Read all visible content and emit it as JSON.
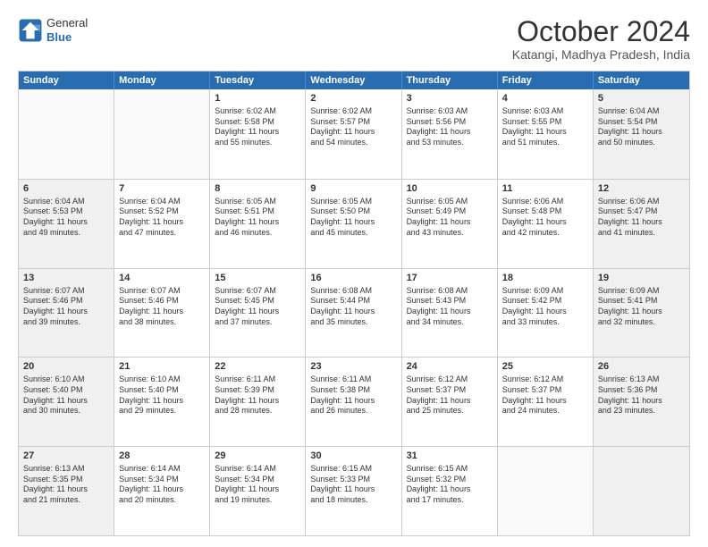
{
  "header": {
    "logo": {
      "general": "General",
      "blue": "Blue"
    },
    "title": "October 2024",
    "subtitle": "Katangi, Madhya Pradesh, India"
  },
  "days_of_week": [
    "Sunday",
    "Monday",
    "Tuesday",
    "Wednesday",
    "Thursday",
    "Friday",
    "Saturday"
  ],
  "weeks": [
    [
      {
        "day": "",
        "empty": true,
        "shaded": false,
        "lines": []
      },
      {
        "day": "",
        "empty": true,
        "shaded": false,
        "lines": []
      },
      {
        "day": "1",
        "empty": false,
        "shaded": false,
        "lines": [
          "Sunrise: 6:02 AM",
          "Sunset: 5:58 PM",
          "Daylight: 11 hours",
          "and 55 minutes."
        ]
      },
      {
        "day": "2",
        "empty": false,
        "shaded": false,
        "lines": [
          "Sunrise: 6:02 AM",
          "Sunset: 5:57 PM",
          "Daylight: 11 hours",
          "and 54 minutes."
        ]
      },
      {
        "day": "3",
        "empty": false,
        "shaded": false,
        "lines": [
          "Sunrise: 6:03 AM",
          "Sunset: 5:56 PM",
          "Daylight: 11 hours",
          "and 53 minutes."
        ]
      },
      {
        "day": "4",
        "empty": false,
        "shaded": false,
        "lines": [
          "Sunrise: 6:03 AM",
          "Sunset: 5:55 PM",
          "Daylight: 11 hours",
          "and 51 minutes."
        ]
      },
      {
        "day": "5",
        "empty": false,
        "shaded": true,
        "lines": [
          "Sunrise: 6:04 AM",
          "Sunset: 5:54 PM",
          "Daylight: 11 hours",
          "and 50 minutes."
        ]
      }
    ],
    [
      {
        "day": "6",
        "empty": false,
        "shaded": true,
        "lines": [
          "Sunrise: 6:04 AM",
          "Sunset: 5:53 PM",
          "Daylight: 11 hours",
          "and 49 minutes."
        ]
      },
      {
        "day": "7",
        "empty": false,
        "shaded": false,
        "lines": [
          "Sunrise: 6:04 AM",
          "Sunset: 5:52 PM",
          "Daylight: 11 hours",
          "and 47 minutes."
        ]
      },
      {
        "day": "8",
        "empty": false,
        "shaded": false,
        "lines": [
          "Sunrise: 6:05 AM",
          "Sunset: 5:51 PM",
          "Daylight: 11 hours",
          "and 46 minutes."
        ]
      },
      {
        "day": "9",
        "empty": false,
        "shaded": false,
        "lines": [
          "Sunrise: 6:05 AM",
          "Sunset: 5:50 PM",
          "Daylight: 11 hours",
          "and 45 minutes."
        ]
      },
      {
        "day": "10",
        "empty": false,
        "shaded": false,
        "lines": [
          "Sunrise: 6:05 AM",
          "Sunset: 5:49 PM",
          "Daylight: 11 hours",
          "and 43 minutes."
        ]
      },
      {
        "day": "11",
        "empty": false,
        "shaded": false,
        "lines": [
          "Sunrise: 6:06 AM",
          "Sunset: 5:48 PM",
          "Daylight: 11 hours",
          "and 42 minutes."
        ]
      },
      {
        "day": "12",
        "empty": false,
        "shaded": true,
        "lines": [
          "Sunrise: 6:06 AM",
          "Sunset: 5:47 PM",
          "Daylight: 11 hours",
          "and 41 minutes."
        ]
      }
    ],
    [
      {
        "day": "13",
        "empty": false,
        "shaded": true,
        "lines": [
          "Sunrise: 6:07 AM",
          "Sunset: 5:46 PM",
          "Daylight: 11 hours",
          "and 39 minutes."
        ]
      },
      {
        "day": "14",
        "empty": false,
        "shaded": false,
        "lines": [
          "Sunrise: 6:07 AM",
          "Sunset: 5:46 PM",
          "Daylight: 11 hours",
          "and 38 minutes."
        ]
      },
      {
        "day": "15",
        "empty": false,
        "shaded": false,
        "lines": [
          "Sunrise: 6:07 AM",
          "Sunset: 5:45 PM",
          "Daylight: 11 hours",
          "and 37 minutes."
        ]
      },
      {
        "day": "16",
        "empty": false,
        "shaded": false,
        "lines": [
          "Sunrise: 6:08 AM",
          "Sunset: 5:44 PM",
          "Daylight: 11 hours",
          "and 35 minutes."
        ]
      },
      {
        "day": "17",
        "empty": false,
        "shaded": false,
        "lines": [
          "Sunrise: 6:08 AM",
          "Sunset: 5:43 PM",
          "Daylight: 11 hours",
          "and 34 minutes."
        ]
      },
      {
        "day": "18",
        "empty": false,
        "shaded": false,
        "lines": [
          "Sunrise: 6:09 AM",
          "Sunset: 5:42 PM",
          "Daylight: 11 hours",
          "and 33 minutes."
        ]
      },
      {
        "day": "19",
        "empty": false,
        "shaded": true,
        "lines": [
          "Sunrise: 6:09 AM",
          "Sunset: 5:41 PM",
          "Daylight: 11 hours",
          "and 32 minutes."
        ]
      }
    ],
    [
      {
        "day": "20",
        "empty": false,
        "shaded": true,
        "lines": [
          "Sunrise: 6:10 AM",
          "Sunset: 5:40 PM",
          "Daylight: 11 hours",
          "and 30 minutes."
        ]
      },
      {
        "day": "21",
        "empty": false,
        "shaded": false,
        "lines": [
          "Sunrise: 6:10 AM",
          "Sunset: 5:40 PM",
          "Daylight: 11 hours",
          "and 29 minutes."
        ]
      },
      {
        "day": "22",
        "empty": false,
        "shaded": false,
        "lines": [
          "Sunrise: 6:11 AM",
          "Sunset: 5:39 PM",
          "Daylight: 11 hours",
          "and 28 minutes."
        ]
      },
      {
        "day": "23",
        "empty": false,
        "shaded": false,
        "lines": [
          "Sunrise: 6:11 AM",
          "Sunset: 5:38 PM",
          "Daylight: 11 hours",
          "and 26 minutes."
        ]
      },
      {
        "day": "24",
        "empty": false,
        "shaded": false,
        "lines": [
          "Sunrise: 6:12 AM",
          "Sunset: 5:37 PM",
          "Daylight: 11 hours",
          "and 25 minutes."
        ]
      },
      {
        "day": "25",
        "empty": false,
        "shaded": false,
        "lines": [
          "Sunrise: 6:12 AM",
          "Sunset: 5:37 PM",
          "Daylight: 11 hours",
          "and 24 minutes."
        ]
      },
      {
        "day": "26",
        "empty": false,
        "shaded": true,
        "lines": [
          "Sunrise: 6:13 AM",
          "Sunset: 5:36 PM",
          "Daylight: 11 hours",
          "and 23 minutes."
        ]
      }
    ],
    [
      {
        "day": "27",
        "empty": false,
        "shaded": true,
        "lines": [
          "Sunrise: 6:13 AM",
          "Sunset: 5:35 PM",
          "Daylight: 11 hours",
          "and 21 minutes."
        ]
      },
      {
        "day": "28",
        "empty": false,
        "shaded": false,
        "lines": [
          "Sunrise: 6:14 AM",
          "Sunset: 5:34 PM",
          "Daylight: 11 hours",
          "and 20 minutes."
        ]
      },
      {
        "day": "29",
        "empty": false,
        "shaded": false,
        "lines": [
          "Sunrise: 6:14 AM",
          "Sunset: 5:34 PM",
          "Daylight: 11 hours",
          "and 19 minutes."
        ]
      },
      {
        "day": "30",
        "empty": false,
        "shaded": false,
        "lines": [
          "Sunrise: 6:15 AM",
          "Sunset: 5:33 PM",
          "Daylight: 11 hours",
          "and 18 minutes."
        ]
      },
      {
        "day": "31",
        "empty": false,
        "shaded": false,
        "lines": [
          "Sunrise: 6:15 AM",
          "Sunset: 5:32 PM",
          "Daylight: 11 hours",
          "and 17 minutes."
        ]
      },
      {
        "day": "",
        "empty": true,
        "shaded": false,
        "lines": []
      },
      {
        "day": "",
        "empty": true,
        "shaded": true,
        "lines": []
      }
    ]
  ]
}
